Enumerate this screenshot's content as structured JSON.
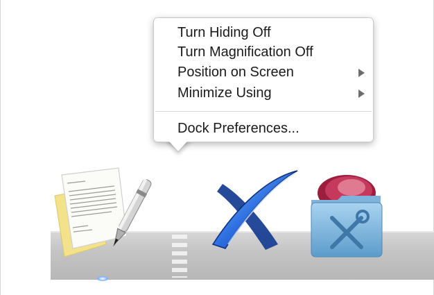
{
  "context_menu": {
    "items": [
      {
        "label": "Turn Hiding Off",
        "has_submenu": false
      },
      {
        "label": "Turn Magnification Off",
        "has_submenu": false
      },
      {
        "label": "Position on Screen",
        "has_submenu": true
      },
      {
        "label": "Minimize Using",
        "has_submenu": true
      }
    ],
    "footer_item": {
      "label": "Dock Preferences..."
    }
  },
  "dock": {
    "icons": [
      {
        "name": "textedit-app-icon",
        "running": true
      },
      {
        "name": "xcode-app-icon",
        "running": false
      },
      {
        "name": "utilities-folder-icon",
        "running": false
      }
    ]
  }
}
